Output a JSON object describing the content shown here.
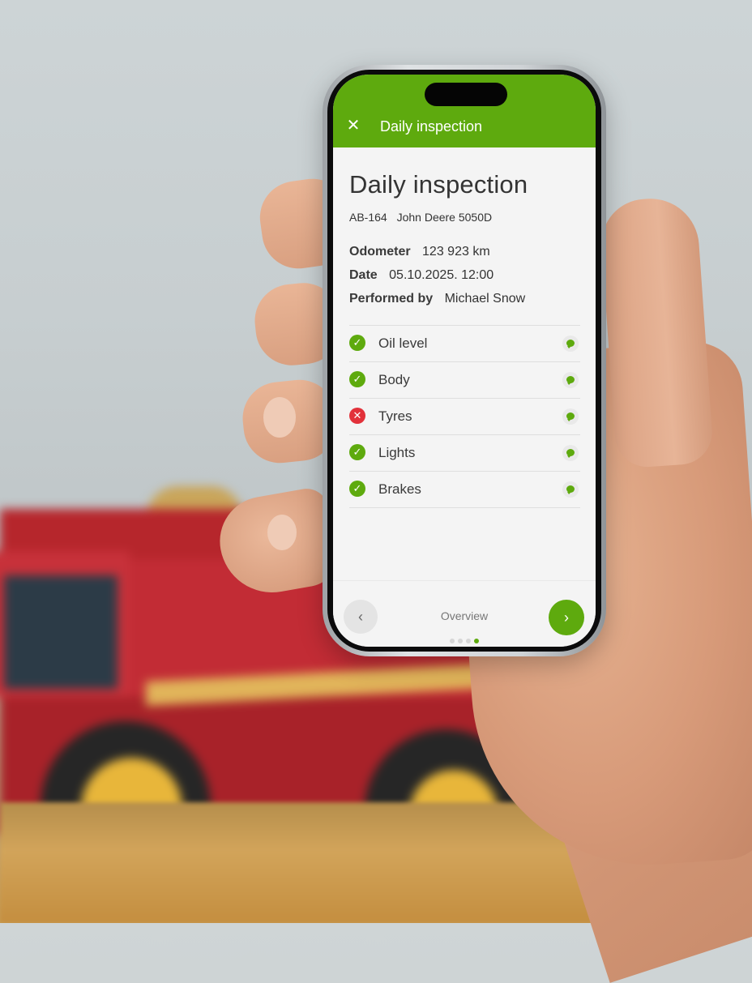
{
  "app": {
    "header_title": "Daily inspection",
    "close_icon": "close-icon",
    "accent_color": "#5eaa0e",
    "fail_color": "#e2313a"
  },
  "inspection": {
    "title": "Daily inspection",
    "vehicle_code": "AB-164",
    "vehicle_name": "John Deere 5050D",
    "odometer_label": "Odometer",
    "odometer_value": "123 923 km",
    "date_label": "Date",
    "date_value": "05.10.2025. 12:00",
    "performed_label": "Performed by",
    "performed_value": "Michael Snow"
  },
  "checks": [
    {
      "label": "Oil level",
      "status": "ok",
      "status_icon": "check-icon",
      "comment_icon": "comment-icon"
    },
    {
      "label": "Body",
      "status": "ok",
      "status_icon": "check-icon",
      "comment_icon": "comment-icon"
    },
    {
      "label": "Tyres",
      "status": "fail",
      "status_icon": "cross-icon",
      "comment_icon": "comment-icon"
    },
    {
      "label": "Lights",
      "status": "ok",
      "status_icon": "check-icon",
      "comment_icon": "comment-icon"
    },
    {
      "label": "Brakes",
      "status": "ok",
      "status_icon": "check-icon",
      "comment_icon": "comment-icon"
    }
  ],
  "footer": {
    "step_label": "Overview",
    "prev_icon": "chevron-left-icon",
    "next_icon": "chevron-right-icon",
    "total_steps": 4,
    "current_step": 4
  }
}
